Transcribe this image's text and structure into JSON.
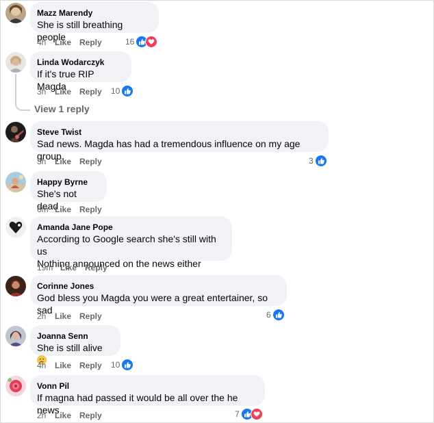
{
  "thread": {
    "view_replies_label": "View 1 reply"
  },
  "comments": [
    {
      "author": "Mazz Marendy",
      "text": "She is still breathing people",
      "time": "4h",
      "like_label": "Like",
      "reply_label": "Reply",
      "reaction_count": "16",
      "reactions": [
        "like-icon",
        "love-icon"
      ]
    },
    {
      "author": "Linda Wodarczyk",
      "text": "If it's true RIP Magda",
      "time": "3h",
      "like_label": "Like",
      "reply_label": "Reply",
      "reaction_count": "10",
      "reactions": [
        "like-icon"
      ]
    },
    {
      "author": "Steve Twist",
      "text": "Sad news. Magda has had a tremendous influence on my age group.",
      "time": "3h",
      "like_label": "Like",
      "reply_label": "Reply",
      "reaction_count": "3",
      "reactions": [
        "like-icon"
      ]
    },
    {
      "author": "Happy Byrne",
      "text": "She's not dead",
      "time": "6m",
      "like_label": "Like",
      "reply_label": "Reply"
    },
    {
      "author": "Amanda Jane Pope",
      "text_lines": [
        "According to Google search she's still with us",
        "Nothing announced on the news either"
      ],
      "time": "19m",
      "like_label": "Like",
      "reply_label": "Reply"
    },
    {
      "author": "Corinne Jones",
      "text": "God bless you Magda you were a great entertainer, so sad",
      "time": "2h",
      "like_label": "Like",
      "reply_label": "Reply",
      "reaction_count": "6",
      "reactions": [
        "like-icon"
      ]
    },
    {
      "author": "Joanna Senn",
      "text": "She is still alive",
      "emoji": "slightly-frowning-face-icon",
      "time": "4h",
      "like_label": "Like",
      "reply_label": "Reply",
      "reaction_count": "10",
      "reactions": [
        "like-icon"
      ]
    },
    {
      "author": "Vonn Pil",
      "text": "If magna had passed it would be all over the he news",
      "time": "2h",
      "like_label": "Like",
      "reply_label": "Reply",
      "reaction_count": "7",
      "reactions": [
        "like-icon",
        "love-icon"
      ]
    }
  ],
  "colors": {
    "bubble": "#f0f2f5",
    "like_blue": "#1877f2",
    "love_red": "#f33e58",
    "meta_gray": "#65676b"
  }
}
